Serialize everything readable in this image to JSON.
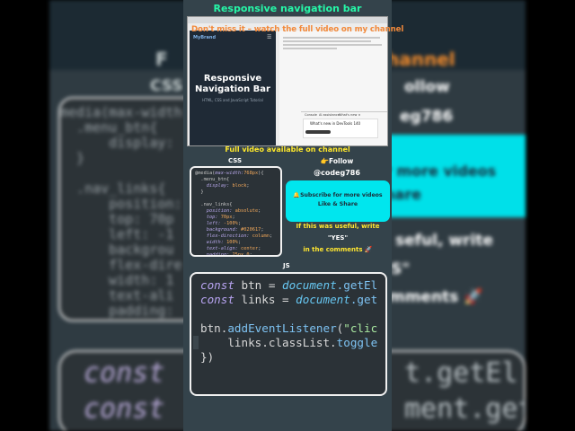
{
  "page_title": "Responsive navigation bar",
  "video": {
    "banner": "Don't miss it – watch the full video on my channel",
    "preview_title_line1": "Responsive",
    "preview_title_line2": "Navigation Bar",
    "preview_brand": "MyBrand",
    "preview_subtitle": "HTML, CSS and JavaScript Tutorial",
    "chat_text": "What's new in DevTools 140",
    "tab_labels": [
      "Console",
      "AI assistance",
      "What's new ×"
    ]
  },
  "full_video_text": "Full video available on channel",
  "follow": {
    "label": "👉Follow",
    "handle": "@codeg786"
  },
  "subscribe": {
    "line1": "🔔Subscribe for more videos",
    "line2": "Like & Share"
  },
  "prompt": {
    "line1": "If this was useful, write",
    "line2": "\"YES\"",
    "line3": "in the comments 🚀"
  },
  "css_section": {
    "label": "CSS",
    "lines": [
      {
        "a": "@media(",
        "b": "max-width:",
        "c": "768px",
        "d": "){"
      },
      {
        "a": "  .menu_btn{",
        "b": "",
        "c": "",
        "d": ""
      },
      {
        "a": "    ",
        "b": "display:",
        "c": " block",
        "d": ";"
      },
      {
        "a": "  }",
        "b": "",
        "c": "",
        "d": ""
      },
      {
        "a": "",
        "b": "",
        "c": "",
        "d": ""
      },
      {
        "a": "  .nav_links{",
        "b": "",
        "c": "",
        "d": ""
      },
      {
        "a": "    ",
        "b": "position:",
        "c": " absolute",
        "d": ";"
      },
      {
        "a": "    ",
        "b": "top:",
        "c": " 70px",
        "d": ";"
      },
      {
        "a": "    ",
        "b": "left:",
        "c": " -100%",
        "d": ";"
      },
      {
        "a": "    ",
        "b": "background:",
        "c": " #020617",
        "d": ";"
      },
      {
        "a": "    ",
        "b": "flex-direction:",
        "c": " column",
        "d": ";"
      },
      {
        "a": "    ",
        "b": "width:",
        "c": " 100%",
        "d": ";"
      },
      {
        "a": "    ",
        "b": "text-align:",
        "c": " center",
        "d": ";"
      },
      {
        "a": "    ",
        "b": "padding:",
        "c": " 25px 0",
        "d": ";"
      }
    ]
  },
  "js_section": {
    "label": "JS",
    "line1": {
      "kw": "const",
      "id": " btn = ",
      "ob": "document",
      "rest": ".getEl"
    },
    "line2": {
      "kw": "const",
      "id": " links = ",
      "ob": "document",
      "rest": ".get"
    },
    "line3": {
      "id": "btn.",
      "fn": "addEventListener",
      "p": "(",
      "st": "\"clic"
    },
    "line4": {
      "id": "    links.classList.",
      "fn": "toggle"
    },
    "line5": {
      "id": "})"
    }
  },
  "background": {
    "left_label": "F",
    "css_label": "CSS",
    "right_label": "hannel",
    "follow_tail": "ollow",
    "handle_tail": "eg786",
    "sub_tail1": "r more videos",
    "sub_tail2": "hare",
    "useful_tail": "seful, write",
    "yes_tail": "S\"",
    "comments_tail": "mments 🚀",
    "code_lines": [
      "media(max-width:",
      "  .menu_btn{",
      "      display:",
      "  }",
      "",
      "  .nav_links{",
      "      position:",
      "      top: 70p",
      "      left: -1",
      "      backgrou",
      "      flex-dire",
      "      width: 1",
      "      text-ali",
      "      padding:"
    ],
    "big_line1": "const",
    "big_line1_tail": "t.getEl",
    "big_line2": "const",
    "big_line2_tail": "ment.get"
  },
  "colors": {
    "title_green": "#26f7a8",
    "banner_orange": "#f2893a",
    "yellow": "#ffe92b",
    "cyan": "#00e6ee",
    "panel": "#34434b"
  }
}
